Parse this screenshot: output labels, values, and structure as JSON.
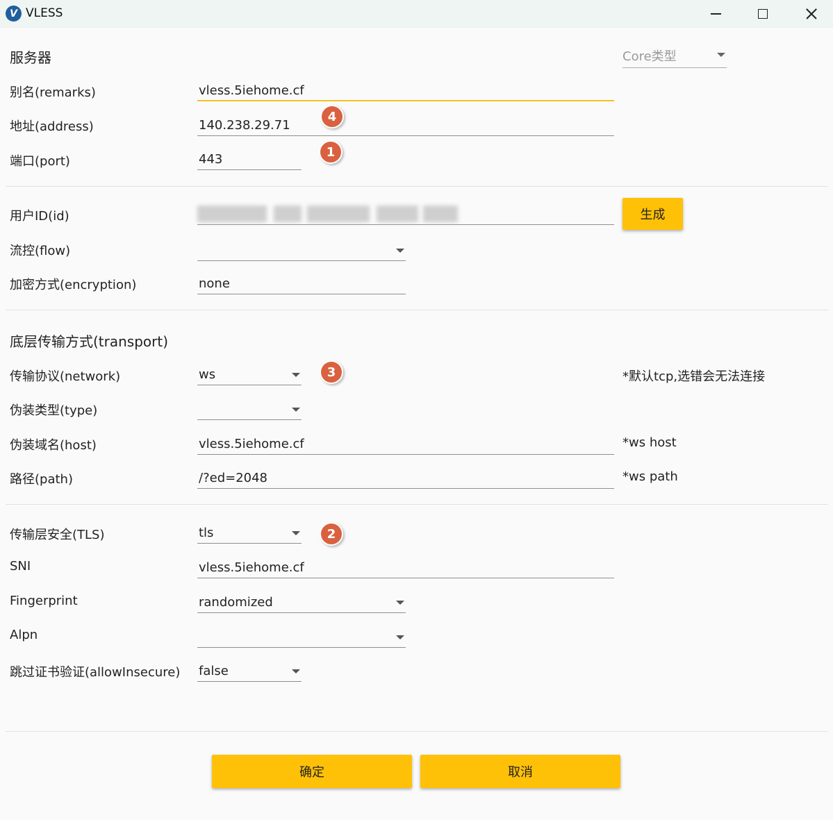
{
  "window": {
    "title": "VLESS",
    "icon": "v-logo-icon"
  },
  "server": {
    "section_title": "服务器",
    "core_type_placeholder": "Core类型",
    "remarks_label": "别名(remarks)",
    "remarks_value": "vless.5iehome.cf",
    "address_label": "地址(address)",
    "address_value": "140.238.29.71",
    "port_label": "端口(port)",
    "port_value": "443"
  },
  "user": {
    "id_label": "用户ID(id)",
    "generate_button": "生成",
    "flow_label": "流控(flow)",
    "flow_value": "",
    "encryption_label": "加密方式(encryption)",
    "encryption_value": "none"
  },
  "transport": {
    "section_title": "底层传输方式(transport)",
    "network_label": "传输协议(network)",
    "network_value": "ws",
    "network_note": "*默认tcp,选错会无法连接",
    "type_label": "伪装类型(type)",
    "type_value": "",
    "host_label": "伪装域名(host)",
    "host_value": "vless.5iehome.cf",
    "host_note": "*ws host",
    "path_label": "路径(path)",
    "path_value": "/?ed=2048",
    "path_note": "*ws path"
  },
  "tls": {
    "security_label": "传输层安全(TLS)",
    "security_value": "tls",
    "sni_label": "SNI",
    "sni_value": "vless.5iehome.cf",
    "fingerprint_label": "Fingerprint",
    "fingerprint_value": "randomized",
    "alpn_label": "Alpn",
    "alpn_value": "",
    "insecure_label": "跳过证书验证(allowInsecure)",
    "insecure_value": "false"
  },
  "badges": {
    "address": "4",
    "port": "1",
    "network": "3",
    "tls": "2"
  },
  "footer": {
    "ok_button": "确定",
    "cancel_button": "取消"
  },
  "colors": {
    "accent": "#ffc107",
    "focus_underline": "#f5c21b",
    "badge": "#d9613f"
  }
}
